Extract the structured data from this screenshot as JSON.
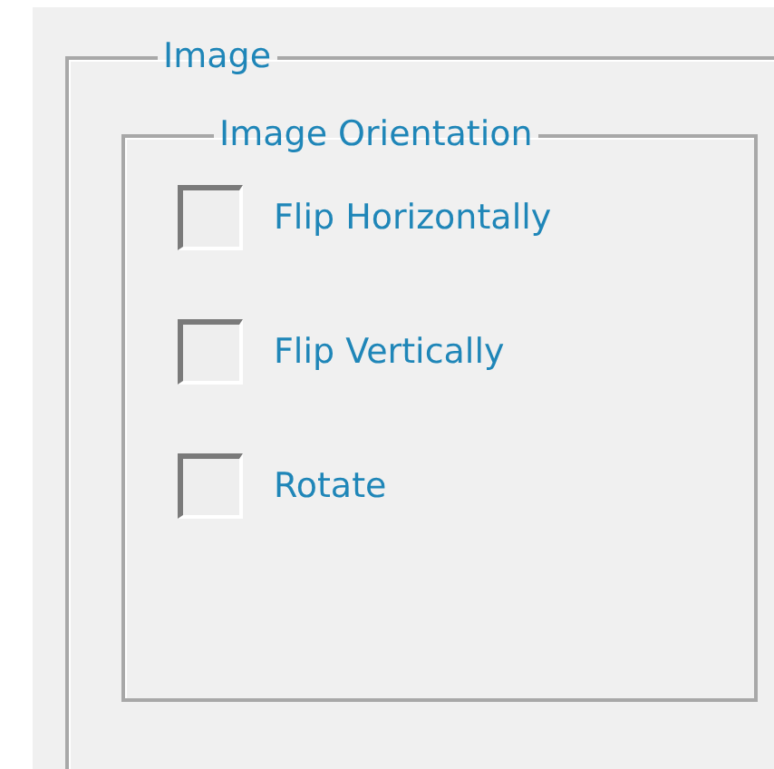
{
  "group": {
    "title": "Image",
    "subgroup": {
      "title": "Image Orientation",
      "options": [
        {
          "label": "Flip Horizontally",
          "checked": false
        },
        {
          "label": "Flip Vertically",
          "checked": false
        },
        {
          "label": "Rotate",
          "checked": false
        }
      ]
    }
  }
}
